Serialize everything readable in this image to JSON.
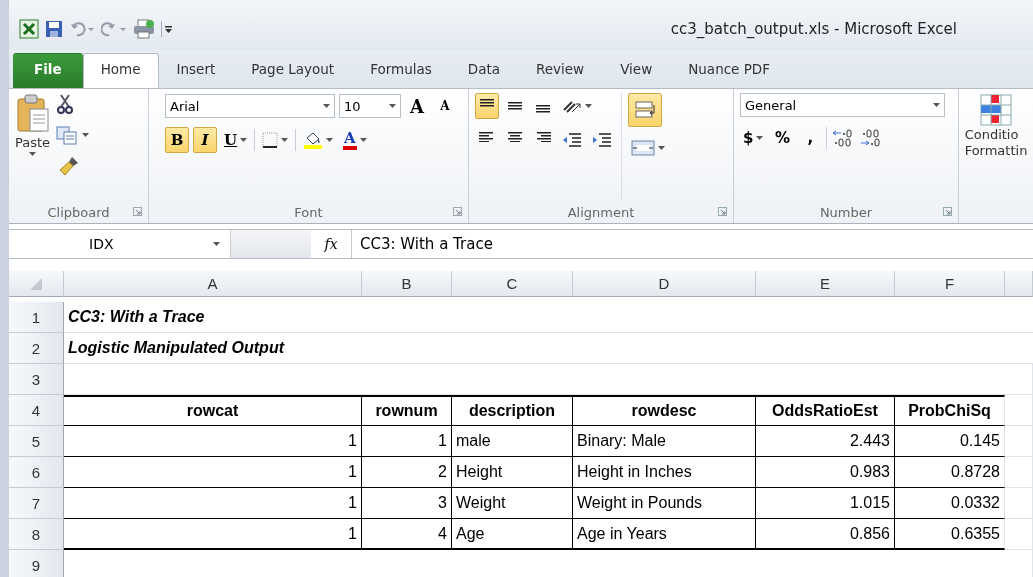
{
  "window": {
    "title": "cc3_batch_output.xls  -  Microsoft Excel"
  },
  "tabs": [
    {
      "label": "File",
      "kind": "file",
      "selected": false
    },
    {
      "label": "Home",
      "kind": "tab",
      "selected": true
    },
    {
      "label": "Insert",
      "kind": "tab",
      "selected": false
    },
    {
      "label": "Page Layout",
      "kind": "tab",
      "selected": false
    },
    {
      "label": "Formulas",
      "kind": "tab",
      "selected": false
    },
    {
      "label": "Data",
      "kind": "tab",
      "selected": false
    },
    {
      "label": "Review",
      "kind": "tab",
      "selected": false
    },
    {
      "label": "View",
      "kind": "tab",
      "selected": false
    },
    {
      "label": "Nuance PDF",
      "kind": "tab",
      "selected": false
    }
  ],
  "ribbon": {
    "clipboard": {
      "label": "Clipboard",
      "paste": "Paste"
    },
    "font": {
      "label": "Font",
      "font_name": "Arial",
      "font_size": "10",
      "grow": "A",
      "shrink": "A",
      "font_color": "A",
      "styles": [
        {
          "label": "B",
          "kind": "bold",
          "on": true
        },
        {
          "label": "I",
          "kind": "italic",
          "on": true
        },
        {
          "label": "U",
          "kind": "underline",
          "on": false
        }
      ]
    },
    "alignment": {
      "label": "Alignment",
      "vertical": [
        {
          "kind": "top",
          "on": true
        },
        {
          "kind": "middle",
          "on": false
        },
        {
          "kind": "bottom",
          "on": false
        }
      ],
      "wrap_text": {
        "on": true
      }
    },
    "number": {
      "label": "Number",
      "format": "General",
      "currency": "$",
      "percent": "%",
      "comma": ","
    },
    "styles": {
      "conditional_formatting": [
        "Conditio",
        "Formattin"
      ]
    }
  },
  "formula_bar": {
    "name_box": "IDX",
    "fx": "fx",
    "formula": "CC3: With a Trace"
  },
  "sheet": {
    "columns": [
      {
        "letter": "A",
        "kind": "numeric"
      },
      {
        "letter": "B",
        "kind": "numeric"
      },
      {
        "letter": "C",
        "kind": "text"
      },
      {
        "letter": "D",
        "kind": "text"
      },
      {
        "letter": "E",
        "kind": "numeric"
      },
      {
        "letter": "F",
        "kind": "numeric"
      }
    ],
    "rows": [
      {
        "number": "1",
        "kind": "title",
        "text": "CC3: With a Trace"
      },
      {
        "number": "2",
        "kind": "title",
        "text": "Logistic Manipulated Output"
      },
      {
        "number": "3",
        "kind": "blank"
      },
      {
        "number": "4",
        "kind": "header",
        "cells": [
          "rowcat",
          "rownum",
          "description",
          "rowdesc",
          "OddsRatioEst",
          "ProbChiSq"
        ]
      },
      {
        "number": "5",
        "kind": "data",
        "cells": [
          "1",
          "1",
          "male",
          "Binary: Male",
          "2.443",
          "0.145"
        ]
      },
      {
        "number": "6",
        "kind": "data",
        "cells": [
          "1",
          "2",
          "Height",
          "Height in Inches",
          "0.983",
          "0.8728"
        ]
      },
      {
        "number": "7",
        "kind": "data",
        "cells": [
          "1",
          "3",
          "Weight",
          "Weight in Pounds",
          "1.015",
          "0.0332"
        ]
      },
      {
        "number": "8",
        "kind": "last",
        "cells": [
          "1",
          "4",
          "Age",
          "Age in Years",
          "0.856",
          "0.6355"
        ]
      },
      {
        "number": "9",
        "kind": "blank"
      }
    ]
  }
}
